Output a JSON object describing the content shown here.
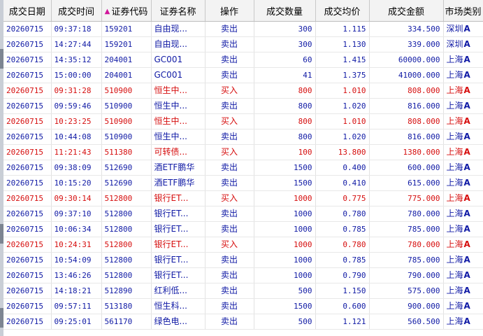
{
  "table": {
    "headers": [
      "成交日期",
      "成交时间",
      "证券代码",
      "证券名称",
      "操作",
      "成交数量",
      "成交均价",
      "成交金额",
      "市场类别"
    ],
    "sort_indicator": "▲",
    "colors": {
      "sell": "#101aa5",
      "buy": "#d60e0e",
      "sort_indicator": "#d0169b"
    },
    "rows": [
      {
        "type": "sell",
        "date": "20260715",
        "time": "09:37:18",
        "code": "159201",
        "name": "自由现...",
        "op": "卖出",
        "qty": "300",
        "avg_price": "1.115",
        "amount": "334.500",
        "market": "深圳",
        "market_suffix": "A"
      },
      {
        "type": "sell",
        "date": "20260715",
        "time": "14:27:44",
        "code": "159201",
        "name": "自由现...",
        "op": "卖出",
        "qty": "300",
        "avg_price": "1.130",
        "amount": "339.000",
        "market": "深圳",
        "market_suffix": "A"
      },
      {
        "type": "sell",
        "date": "20260715",
        "time": "14:35:12",
        "code": "204001",
        "name": "GC001",
        "op": "卖出",
        "qty": "60",
        "avg_price": "1.415",
        "amount": "60000.000",
        "market": "上海",
        "market_suffix": "A"
      },
      {
        "type": "sell",
        "date": "20260715",
        "time": "15:00:00",
        "code": "204001",
        "name": "GC001",
        "op": "卖出",
        "qty": "41",
        "avg_price": "1.375",
        "amount": "41000.000",
        "market": "上海",
        "market_suffix": "A"
      },
      {
        "type": "buy",
        "date": "20260715",
        "time": "09:31:28",
        "code": "510900",
        "name": "恒生中...",
        "op": "买入",
        "qty": "800",
        "avg_price": "1.010",
        "amount": "808.000",
        "market": "上海",
        "market_suffix": "A"
      },
      {
        "type": "sell",
        "date": "20260715",
        "time": "09:59:46",
        "code": "510900",
        "name": "恒生中...",
        "op": "卖出",
        "qty": "800",
        "avg_price": "1.020",
        "amount": "816.000",
        "market": "上海",
        "market_suffix": "A"
      },
      {
        "type": "buy",
        "date": "20260715",
        "time": "10:23:25",
        "code": "510900",
        "name": "恒生中...",
        "op": "买入",
        "qty": "800",
        "avg_price": "1.010",
        "amount": "808.000",
        "market": "上海",
        "market_suffix": "A"
      },
      {
        "type": "sell",
        "date": "20260715",
        "time": "10:44:08",
        "code": "510900",
        "name": "恒生中...",
        "op": "卖出",
        "qty": "800",
        "avg_price": "1.020",
        "amount": "816.000",
        "market": "上海",
        "market_suffix": "A"
      },
      {
        "type": "buy",
        "date": "20260715",
        "time": "11:21:43",
        "code": "511380",
        "name": "可转债...",
        "op": "买入",
        "qty": "100",
        "avg_price": "13.800",
        "amount": "1380.000",
        "market": "上海",
        "market_suffix": "A"
      },
      {
        "type": "sell",
        "date": "20260715",
        "time": "09:38:09",
        "code": "512690",
        "name": "酒ETF鹏华",
        "op": "卖出",
        "qty": "1500",
        "avg_price": "0.400",
        "amount": "600.000",
        "market": "上海",
        "market_suffix": "A"
      },
      {
        "type": "sell",
        "date": "20260715",
        "time": "10:15:20",
        "code": "512690",
        "name": "酒ETF鹏华",
        "op": "卖出",
        "qty": "1500",
        "avg_price": "0.410",
        "amount": "615.000",
        "market": "上海",
        "market_suffix": "A"
      },
      {
        "type": "buy",
        "date": "20260715",
        "time": "09:30:14",
        "code": "512800",
        "name": "银行ET...",
        "op": "买入",
        "qty": "1000",
        "avg_price": "0.775",
        "amount": "775.000",
        "market": "上海",
        "market_suffix": "A"
      },
      {
        "type": "sell",
        "date": "20260715",
        "time": "09:37:10",
        "code": "512800",
        "name": "银行ET...",
        "op": "卖出",
        "qty": "1000",
        "avg_price": "0.780",
        "amount": "780.000",
        "market": "上海",
        "market_suffix": "A"
      },
      {
        "type": "sell",
        "date": "20260715",
        "time": "10:06:34",
        "code": "512800",
        "name": "银行ET...",
        "op": "卖出",
        "qty": "1000",
        "avg_price": "0.785",
        "amount": "785.000",
        "market": "上海",
        "market_suffix": "A"
      },
      {
        "type": "buy",
        "date": "20260715",
        "time": "10:24:31",
        "code": "512800",
        "name": "银行ET...",
        "op": "买入",
        "qty": "1000",
        "avg_price": "0.780",
        "amount": "780.000",
        "market": "上海",
        "market_suffix": "A"
      },
      {
        "type": "sell",
        "date": "20260715",
        "time": "10:54:09",
        "code": "512800",
        "name": "银行ET...",
        "op": "卖出",
        "qty": "1000",
        "avg_price": "0.785",
        "amount": "785.000",
        "market": "上海",
        "market_suffix": "A"
      },
      {
        "type": "sell",
        "date": "20260715",
        "time": "13:46:26",
        "code": "512800",
        "name": "银行ET...",
        "op": "卖出",
        "qty": "1000",
        "avg_price": "0.790",
        "amount": "790.000",
        "market": "上海",
        "market_suffix": "A"
      },
      {
        "type": "sell",
        "date": "20260715",
        "time": "14:18:21",
        "code": "512890",
        "name": "红利低...",
        "op": "卖出",
        "qty": "500",
        "avg_price": "1.150",
        "amount": "575.000",
        "market": "上海",
        "market_suffix": "A"
      },
      {
        "type": "sell",
        "date": "20260715",
        "time": "09:57:11",
        "code": "513180",
        "name": "恒生科...",
        "op": "卖出",
        "qty": "1500",
        "avg_price": "0.600",
        "amount": "900.000",
        "market": "上海",
        "market_suffix": "A"
      },
      {
        "type": "sell",
        "date": "20260715",
        "time": "09:25:01",
        "code": "561170",
        "name": "绿色电...",
        "op": "卖出",
        "qty": "500",
        "avg_price": "1.121",
        "amount": "560.500",
        "market": "上海",
        "market_suffix": "A"
      }
    ]
  }
}
